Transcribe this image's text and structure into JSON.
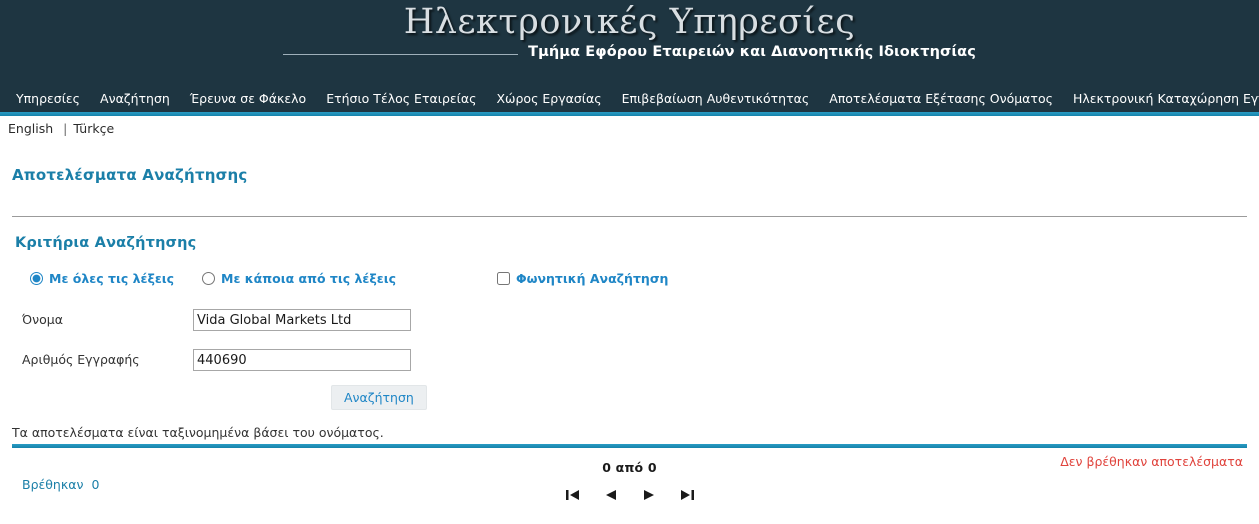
{
  "banner": {
    "title": "Ηλεκτρονικές Υπηρεσίες",
    "subtitle": "Τμήμα Εφόρου Εταιρειών και Διανοητικής Ιδιοκτησίας"
  },
  "nav": {
    "items": [
      {
        "label": "Υπηρεσίες"
      },
      {
        "label": "Αναζήτηση"
      },
      {
        "label": "Έρευνα σε Φάκελο"
      },
      {
        "label": "Ετήσιο Τέλος Εταιρείας"
      },
      {
        "label": "Χώρος Εργασίας"
      },
      {
        "label": "Επιβεβαίωση Αυθεντικότητας"
      },
      {
        "label": "Αποτελέσματα Εξέτασης Ονόματος"
      },
      {
        "label": "Ηλεκτρονική Καταχώρηση Εγγράφων"
      }
    ]
  },
  "language": {
    "english": "English",
    "separator": "|",
    "turkish": "Türkçe"
  },
  "page": {
    "title": "Αποτελέσματα Αναζήτησης",
    "section_title": "Κριτήρια Αναζήτησης"
  },
  "search": {
    "option_all_words": "Με όλες τις λέξεις",
    "option_any_words": "Με κάποια από τις λέξεις",
    "option_phonetic": "Φωνητική Αναζήτηση",
    "name_label": "Όνομα",
    "name_value": "Vida Global Markets Ltd",
    "name_placeholder": "",
    "regno_label": "Αριθμός Εγγραφής",
    "regno_value": "440690",
    "regno_placeholder": "",
    "submit_label": "Αναζήτηση"
  },
  "results": {
    "sort_note": "Τα αποτελέσματα είναι ταξινομημένα βάσει του ονόματος.",
    "no_results": "Δεν βρέθηκαν αποτελέσματα",
    "found_label": "Βρέθηκαν",
    "found_count": "0",
    "pager_label": "0 από 0",
    "pager_first": "first-page-icon",
    "pager_prev": "previous-page-icon",
    "pager_next": "next-page-icon",
    "pager_last": "last-page-icon"
  },
  "colors": {
    "banner_bg": "#1e3541",
    "accent": "#1b8fb5",
    "heading": "#1b7fa8",
    "link_blue": "#1f86c6",
    "error_red": "#e0433c"
  }
}
